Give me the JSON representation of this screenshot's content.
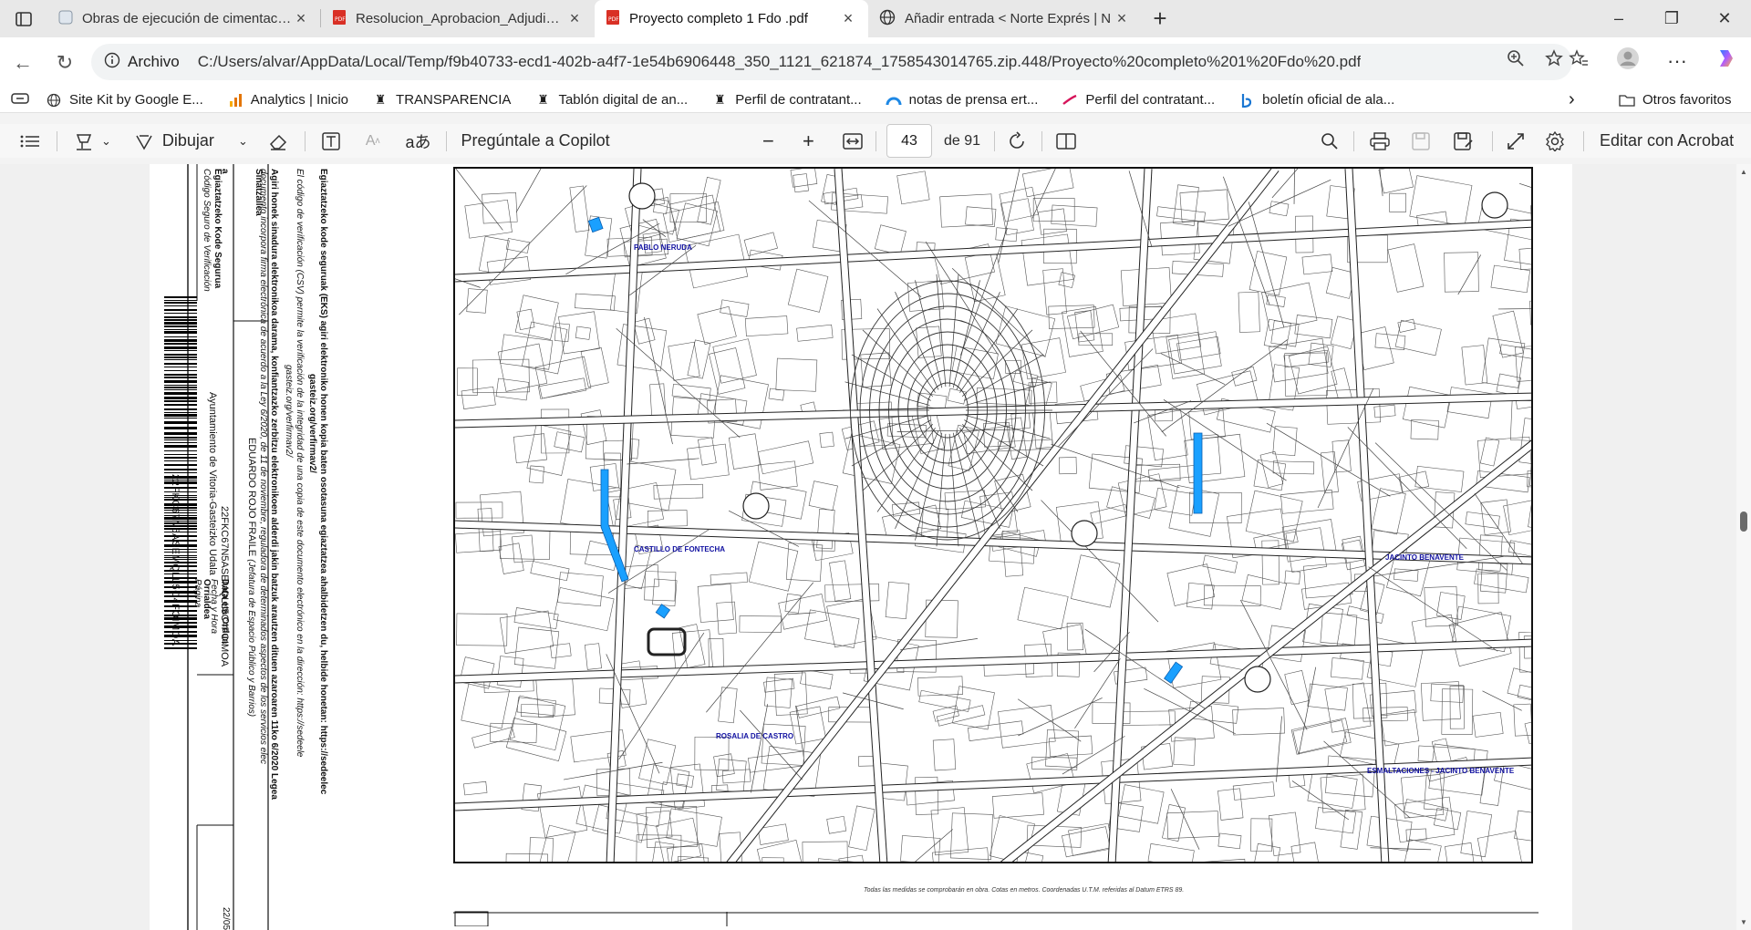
{
  "tabs": [
    {
      "title": "Obras de ejecución de cimentación",
      "icon": "page-icon",
      "active": false
    },
    {
      "title": "Resolucion_Aprobacion_Adjudicacion",
      "icon": "pdf-icon",
      "active": false
    },
    {
      "title": "Proyecto completo 1 Fdo .pdf",
      "icon": "pdf-icon",
      "active": true
    },
    {
      "title": "Añadir entrada < Norte Exprés | N",
      "icon": "globe-icon",
      "active": false
    }
  ],
  "address": {
    "protocol_label": "Archivo",
    "url": "C:/Users/alvar/AppData/Local/Temp/f9b40733-ecd1-402b-a4f7-1e54b6906448_350_1121_621874_1758543014765.zip.448/Proyecto%20completo%201%20Fdo%20.pdf"
  },
  "favorites": [
    {
      "label": "Site Kit by Google E...",
      "icon": "globe-icon"
    },
    {
      "label": "Analytics | Inicio",
      "icon": "analytics-icon"
    },
    {
      "label": "TRANSPARENCIA",
      "icon": "crest-icon"
    },
    {
      "label": "Tablón digital de an...",
      "icon": "crest-icon"
    },
    {
      "label": "Perfil de contratant...",
      "icon": "crest-icon"
    },
    {
      "label": "notas de prensa ert...",
      "icon": "arc-icon"
    },
    {
      "label": "Perfil del contratant...",
      "icon": "check-icon"
    },
    {
      "label": "boletín oficial de ala...",
      "icon": "b-icon"
    }
  ],
  "favorites_other": "Otros favoritos",
  "pdf_toolbar": {
    "draw_label": "Dibujar",
    "copilot_label": "Pregúntale a Copilot",
    "page_current": "43",
    "page_total": "de 91",
    "edit_acrobat": "Editar con Acrobat"
  },
  "doc": {
    "csv_title": "Egiaztatzeko kode seguruak (EKS) agiri elektroniko honen kopia baten osotasuna egiaztatzea ahalbidetzen du, helbide honetan: https://sedeelec",
    "csv_url": "gasteiz.org/verfirmav2/",
    "csv_es": "El código de verificación (CSV) permite la verificación de la integridad de una copia de este documento electrónico en la dirección: https://sedeele",
    "csv_es2": "gasteiz.org/verfirmav2/",
    "sign_eu": "Agiri honek sinadura elektronikoa darama, konfiantzazko zerbitzu elektronikoen alderdi jakin batzuk arautzen dituen azaroaren 11ko 6/2020 Legea",
    "sign_es": "documento incorpora firma electrónica de acuerdo a la Ley 6/2020, de 11 de noviembre, reguladora de determinados aspectos de los servicios elec",
    "signer_header": "Sinatzailea",
    "signer_name": "EDUARDO ROJO FRAILE",
    "signer_role": "(Jefatura de Espacio Público y Barrios)",
    "date_header": "Data eta Ordua",
    "date_header_es": "Fecha y Hora",
    "date_value": "22/05",
    "code_header": "Egiaztatzeko Kode Segurua",
    "code_header_es": "Código Seguro de Verificación",
    "code_value": "22FKC67N5ASEMQLL5C4FOIMOA",
    "page_header": "Orrialdea",
    "page_header_es": "Página",
    "org": "Ayuntamiento de Vitoria-Gasteizko Udala",
    "barcode_text": "22FKC67N5ASEMQLL5C4FOIMOA",
    "eus_cut": "ttea",
    "eus_cut2": "urra",
    "eus_cut3": "a"
  },
  "map": {
    "labels": [
      {
        "text": "PABLO NERUDA"
      },
      {
        "text": "CASTILLO DE FONTECHA"
      },
      {
        "text": "ROSALIA DE CASTRO"
      },
      {
        "text": "JACINTO BENAVENTE"
      },
      {
        "text": "ESMALTACIONES - JACINTO BENAVENTE"
      }
    ],
    "footer_note": "Todas las medidas se comprobarán en obra. Cotas en metros. Coordenadas U.T.M. referidas al Datum ETRS 89.",
    "highlight_color": "#1aa0ff"
  }
}
